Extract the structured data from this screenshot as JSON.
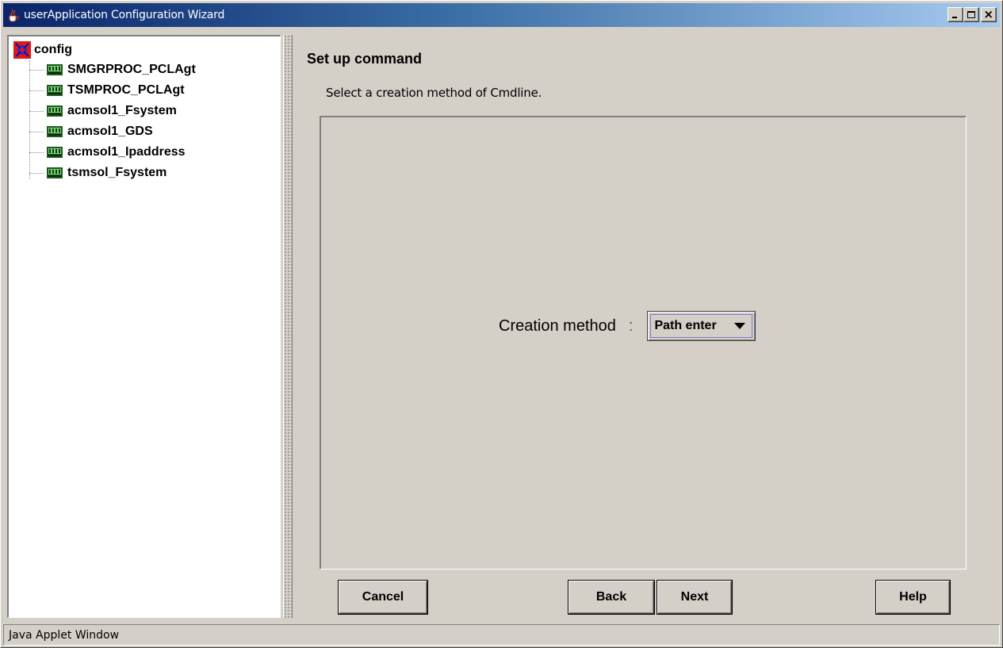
{
  "window": {
    "title": "userApplication Configuration Wizard",
    "title_icon": "java-cup-icon",
    "controls": [
      "minimize-icon",
      "maximize-icon",
      "close-icon"
    ]
  },
  "tree": {
    "root": {
      "label": "config",
      "icon": "config-icon"
    },
    "items": [
      {
        "label": "SMGRPROC_PCLAgt",
        "icon": "resource-icon"
      },
      {
        "label": "TSMPROC_PCLAgt",
        "icon": "resource-icon"
      },
      {
        "label": "acmsol1_Fsystem",
        "icon": "resource-icon"
      },
      {
        "label": "acmsol1_GDS",
        "icon": "resource-icon"
      },
      {
        "label": "acmsol1_Ipaddress",
        "icon": "resource-icon"
      },
      {
        "label": "tsmsol_Fsystem",
        "icon": "resource-icon"
      }
    ]
  },
  "main": {
    "title": "Set up command",
    "instruction": "Select a creation method of Cmdline.",
    "creation_method": {
      "label": "Creation method",
      "separator": ":",
      "value": "Path enter"
    }
  },
  "buttons": {
    "cancel": "Cancel",
    "back": "Back",
    "next": "Next",
    "help": "Help"
  },
  "status": {
    "text": "Java Applet Window"
  }
}
